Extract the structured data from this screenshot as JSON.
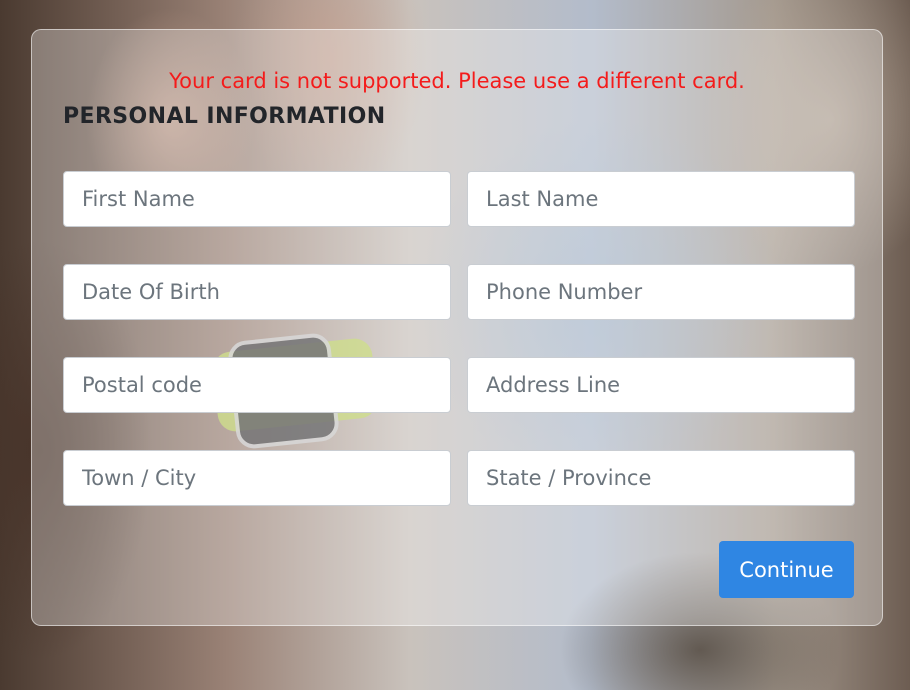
{
  "form": {
    "error_message": "Your card is not supported. Please use a different card.",
    "section_title": "PERSONAL INFORMATION",
    "fields": {
      "first_name": {
        "placeholder": "First Name",
        "value": ""
      },
      "last_name": {
        "placeholder": "Last Name",
        "value": ""
      },
      "date_of_birth": {
        "placeholder": "Date Of Birth",
        "value": ""
      },
      "phone_number": {
        "placeholder": "Phone Number",
        "value": ""
      },
      "postal_code": {
        "placeholder": "Postal code",
        "value": ""
      },
      "address_line": {
        "placeholder": "Address Line",
        "value": ""
      },
      "town_city": {
        "placeholder": "Town / City",
        "value": ""
      },
      "state_province": {
        "placeholder": "State / Province",
        "value": ""
      }
    },
    "continue_label": "Continue"
  },
  "colors": {
    "error": "#f41b1b",
    "primary_button": "#2f86e3",
    "title_text": "#22252a"
  }
}
